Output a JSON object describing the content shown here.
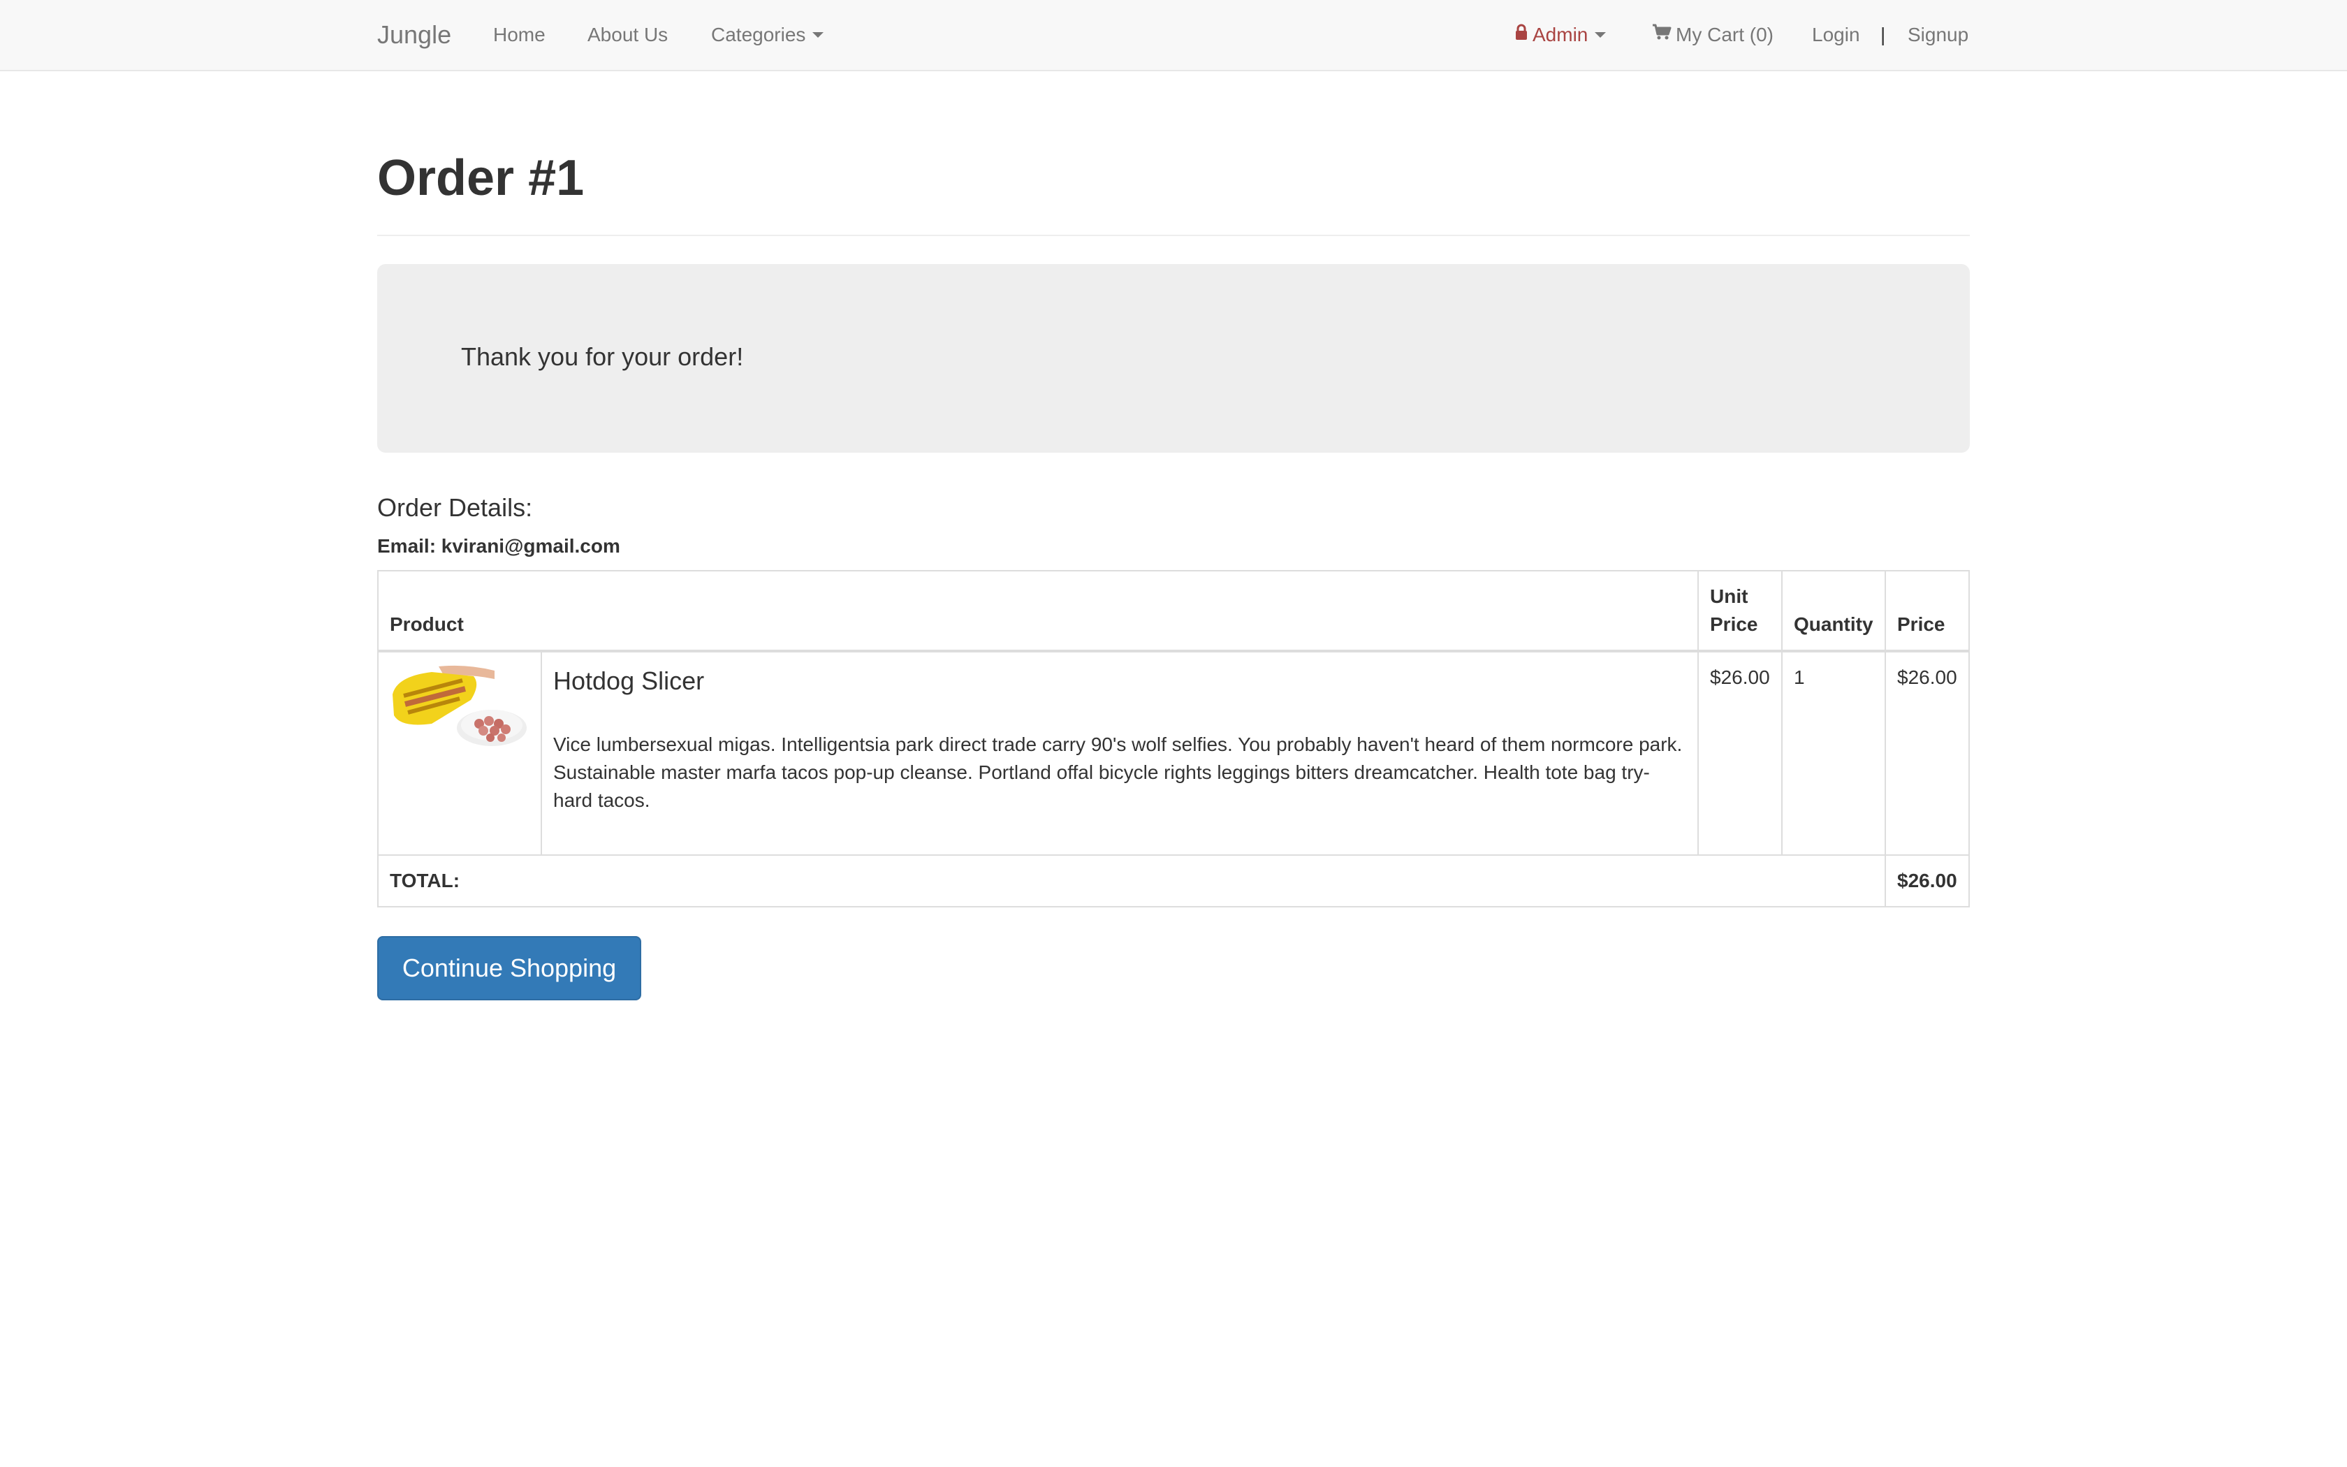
{
  "navbar": {
    "brand": "Jungle",
    "links": {
      "home": "Home",
      "about": "About Us",
      "categories": "Categories"
    },
    "right": {
      "admin": "Admin",
      "cart": "My Cart (0)",
      "login": "Login",
      "separator": "|",
      "signup": "Signup"
    },
    "admin_color": "#a94442"
  },
  "page": {
    "title": "Order #1",
    "thank_you": "Thank you for your order!",
    "details_heading": "Order Details:",
    "email_line": "Email: kvirani@gmail.com"
  },
  "table": {
    "headers": {
      "product": "Product",
      "unit_price_1": "Unit",
      "unit_price_2": "Price",
      "quantity": "Quantity",
      "price": "Price"
    },
    "items": [
      {
        "name": "Hotdog Slicer",
        "description": "Vice lumbersexual migas. Intelligentsia park direct trade carry 90's wolf selfies. You probably haven't heard of them normcore park. Sustainable master marfa tacos pop-up cleanse. Portland offal bicycle rights leggings bitters dreamcatcher. Health tote bag try-hard tacos.",
        "unit_price": "$26.00",
        "quantity": "1",
        "price": "$26.00"
      }
    ],
    "total_label": "TOTAL:",
    "total_value": "$26.00"
  },
  "actions": {
    "continue_shopping": "Continue Shopping"
  },
  "colors": {
    "primary": "#337ab7",
    "navbar_bg": "#f8f8f8",
    "jumbotron_bg": "#eeeeee"
  }
}
